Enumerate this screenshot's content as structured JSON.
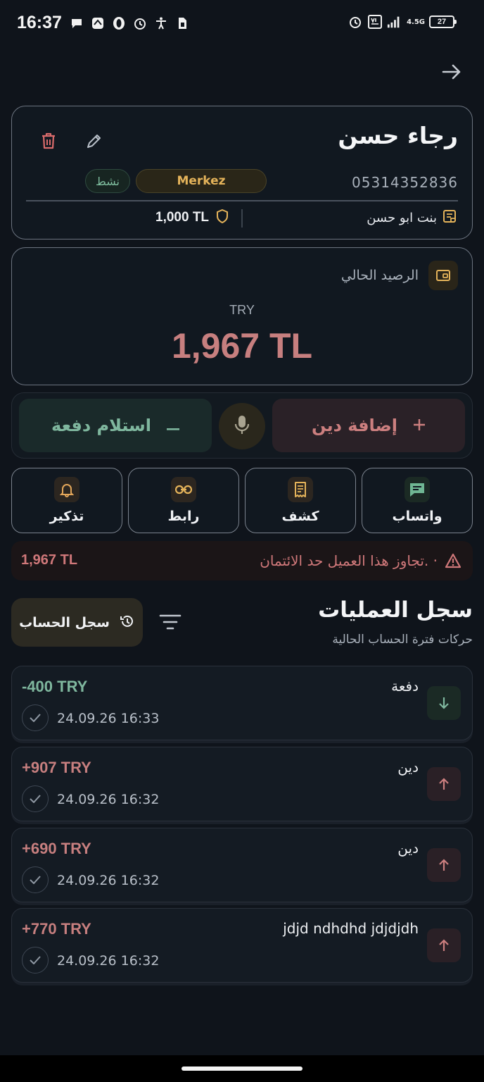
{
  "status_bar": {
    "time": "16:37",
    "network": "4.5G",
    "battery": "27"
  },
  "customer": {
    "name": "رجاء حسن",
    "phone": "05314352836",
    "branch_badge": "Merkez",
    "status_badge": "نشط",
    "note": "بنت ابو حسن",
    "credit_limit": "1,000 TL"
  },
  "balance": {
    "label": "الرصيد الحالي",
    "currency": "TRY",
    "value": "1,967 TL"
  },
  "actions": {
    "receive_payment": "استلام دفعة",
    "add_debt": "إضافة دين"
  },
  "quick_actions": {
    "whatsapp": "واتساب",
    "statement": "كشف",
    "link": "رابط",
    "reminder": "تذكير"
  },
  "warning": {
    "text": "تجاوز هذا العميل حد الائتمان. ·",
    "amount": "1,967 TL"
  },
  "history": {
    "title": "سجل العمليات",
    "subtitle": "حركات فترة الحساب الحالية",
    "statement_button": "سجل الحساب"
  },
  "transactions": [
    {
      "title": "دفعة",
      "amount": "-400 TRY",
      "date": "24.09.26 16:33",
      "type": "payment"
    },
    {
      "title": "دين",
      "amount": "+907 TRY",
      "date": "24.09.26 16:32",
      "type": "debt"
    },
    {
      "title": "دين",
      "amount": "+690 TRY",
      "date": "24.09.26 16:32",
      "type": "debt"
    },
    {
      "title": "jdjd ndhdhd jdjdjdh",
      "amount": "+770 TRY",
      "date": "24.09.26 16:32",
      "type": "debt"
    }
  ],
  "colors": {
    "debt": "#c77f7f",
    "payment": "#7fb79e",
    "accent_gold": "#e4b35a"
  }
}
